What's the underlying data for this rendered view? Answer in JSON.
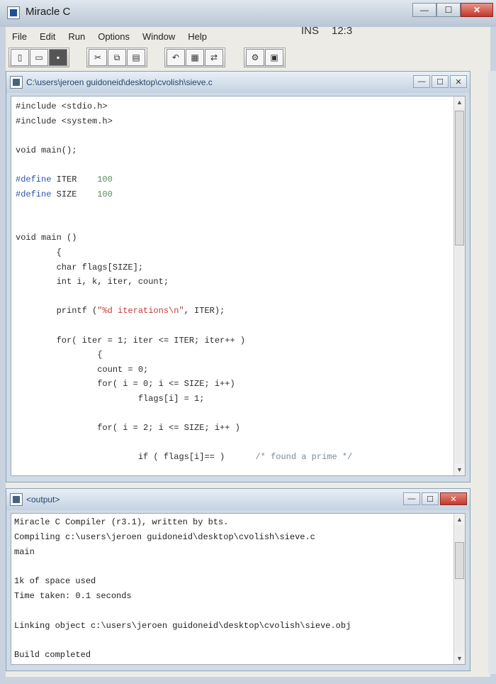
{
  "window": {
    "title": "Miracle C",
    "controls": {
      "minimize": "—",
      "maximize": "☐",
      "close": "✕"
    }
  },
  "menu": [
    "File",
    "Edit",
    "Run",
    "Options",
    "Window",
    "Help"
  ],
  "toolbar": {
    "groups": [
      [
        {
          "icon": "new-file-icon",
          "glyph": "▯"
        },
        {
          "icon": "open-file-icon",
          "glyph": "▭"
        },
        {
          "icon": "save-icon",
          "glyph": "▪"
        }
      ],
      [
        {
          "icon": "cut-icon",
          "glyph": "✂"
        },
        {
          "icon": "copy-icon",
          "glyph": "⧉"
        },
        {
          "icon": "paste-icon",
          "glyph": "▤"
        }
      ],
      [
        {
          "icon": "undo-icon",
          "glyph": "↶"
        },
        {
          "icon": "find-icon",
          "glyph": "▦"
        },
        {
          "icon": "replace-icon",
          "glyph": "⇄"
        }
      ],
      [
        {
          "icon": "compile-icon",
          "glyph": "⚙"
        },
        {
          "icon": "run-icon",
          "glyph": "▣"
        }
      ]
    ],
    "status_mode": "INS",
    "status_position": "12:3"
  },
  "editor_window": {
    "title": "C:\\users\\jeroen guidoneid\\desktop\\cvolish\\sieve.c",
    "controls": {
      "minimize": "—",
      "maximize": "☐",
      "close": "✕"
    },
    "lines": [
      {
        "text": "#include <stdio.h>",
        "cls": ""
      },
      {
        "text": "#include <system.h>",
        "cls": ""
      },
      {
        "text": "",
        "cls": ""
      },
      {
        "text": "void main();",
        "cls": ""
      },
      {
        "text": "",
        "cls": ""
      },
      {
        "text": "#define ITER    100",
        "cls": "define"
      },
      {
        "text": "#define SIZE    100",
        "cls": "define"
      },
      {
        "text": "",
        "cls": ""
      },
      {
        "text": "",
        "cls": ""
      },
      {
        "text": "void main ()",
        "cls": ""
      },
      {
        "text": "        {",
        "cls": ""
      },
      {
        "text": "        char flags[SIZE];",
        "cls": ""
      },
      {
        "text": "        int i, k, iter, count;",
        "cls": ""
      },
      {
        "text": "",
        "cls": ""
      },
      {
        "text": "        printf (\"%d iterations\\n\", ITER);",
        "cls": "printf"
      },
      {
        "text": "",
        "cls": ""
      },
      {
        "text": "        for( iter = 1; iter <= ITER; iter++ )",
        "cls": ""
      },
      {
        "text": "                {",
        "cls": ""
      },
      {
        "text": "                count = 0;",
        "cls": ""
      },
      {
        "text": "                for( i = 0; i <= SIZE; i++)",
        "cls": ""
      },
      {
        "text": "                        flags[i] = 1;",
        "cls": ""
      },
      {
        "text": "",
        "cls": ""
      },
      {
        "text": "                for( i = 2; i <= SIZE; i++ )",
        "cls": ""
      },
      {
        "text": "",
        "cls": ""
      },
      {
        "text": "                        if ( flags[i]== )      /* found a prime */",
        "cls": "comment"
      }
    ]
  },
  "output_window": {
    "title": "<output>",
    "controls": {
      "minimize": "—",
      "maximize": "☐",
      "close": "✕"
    },
    "lines": [
      "Miracle C Compiler (r3.1), written by bts.",
      "Compiling c:\\users\\jeroen guidoneid\\desktop\\cvolish\\sieve.c",
      "main",
      "",
      "1k of space used",
      "Time taken: 0.1 seconds",
      "",
      "Linking object c:\\users\\jeroen guidoneid\\desktop\\cvolish\\sieve.obj",
      "",
      "Build completed"
    ]
  },
  "scroll": {
    "up": "▲",
    "down": "▼"
  }
}
